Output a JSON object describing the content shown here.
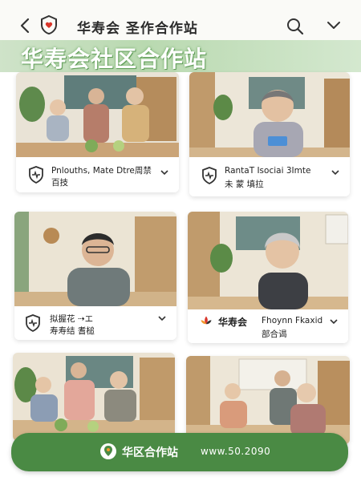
{
  "header": {
    "back_glyph": "‹",
    "app_name": "华寿会 圣作合作站",
    "hero_title": "华寿会社区合作站",
    "icons": [
      "chevron-left-icon",
      "shield-heart-icon",
      "search-icon",
      "chevron-down-icon"
    ]
  },
  "cards": [
    {
      "line1": "Pnlouths, Mate Dtre周禁",
      "line2": "百技",
      "icon": "shield-heart-icon"
    },
    {
      "line1": "RantaT Isociai 3Imte",
      "line2": "未 蒙 填拉",
      "icon": "shield-heart-icon"
    },
    {
      "line1": "拟握花 ⇢エ",
      "line2": "寿寿结 耆槌",
      "icon": "shield-heart-icon"
    },
    {
      "brand": "华寿会",
      "line1": "Fhoynn Fkaxid",
      "line2": "部合谒",
      "icon": "lotus-logo-icon"
    }
  ],
  "bottom_bar": {
    "name": "华区合作站",
    "url": "www.50.2090",
    "icon": "location-pin-icon"
  },
  "colors": {
    "brand_green": "#4a8a44",
    "hero_band": "#b9d9b0",
    "logo_red": "#d9362b",
    "logo_orange": "#f29a2e"
  }
}
